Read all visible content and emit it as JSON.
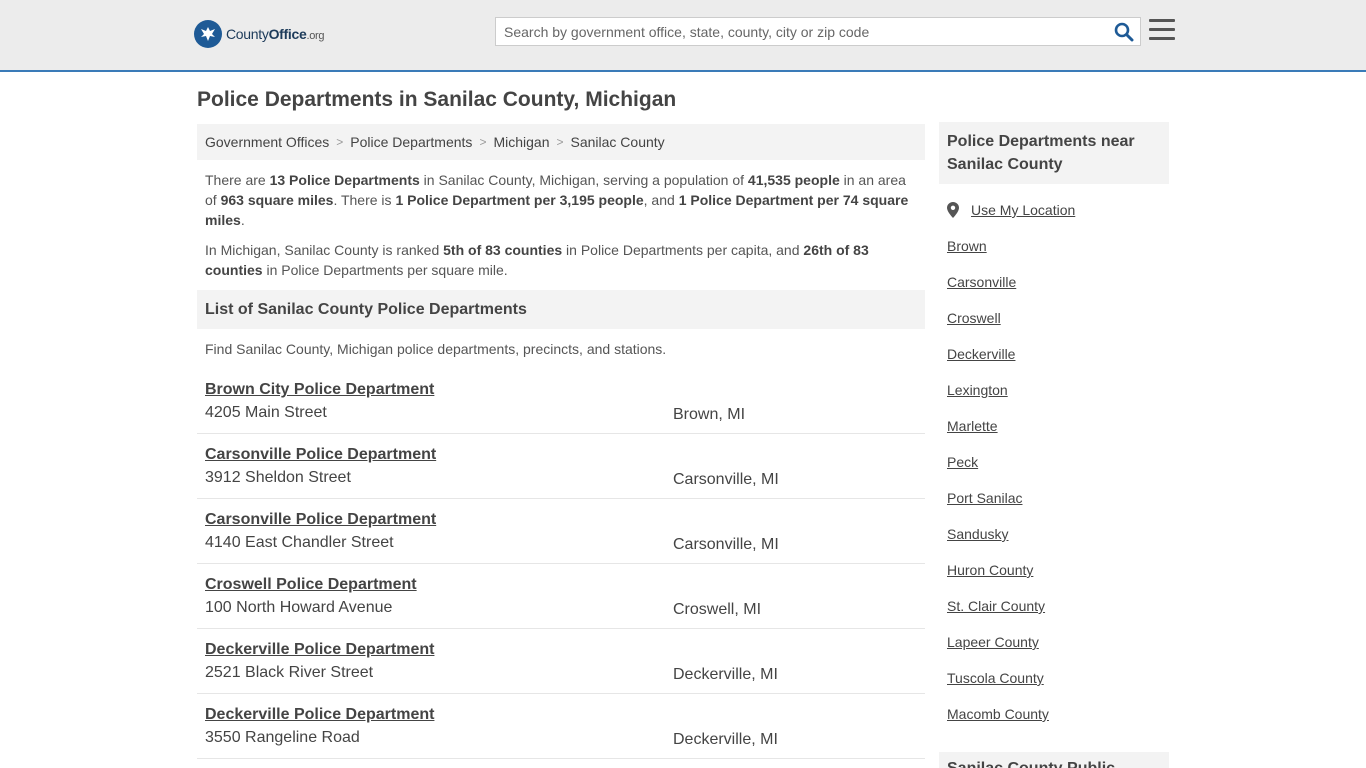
{
  "header": {
    "logo_prefix": "County",
    "logo_bold": "Office",
    "logo_tld": ".org",
    "search_placeholder": "Search by government office, state, county, city or zip code",
    "accent_color": "#3a7bb8"
  },
  "page": {
    "title": "Police Departments in Sanilac County, Michigan"
  },
  "breadcrumb": [
    "Government Offices",
    "Police Departments",
    "Michigan",
    "Sanilac County"
  ],
  "intro": {
    "p1": [
      {
        "t": "There are ",
        "b": false
      },
      {
        "t": "13 Police Departments",
        "b": true
      },
      {
        "t": " in Sanilac County, Michigan, serving a population of ",
        "b": false
      },
      {
        "t": "41,535 people",
        "b": true
      },
      {
        "t": " in an area of ",
        "b": false
      },
      {
        "t": "963 square miles",
        "b": true
      },
      {
        "t": ". There is ",
        "b": false
      },
      {
        "t": "1 Police Department per 3,195 people",
        "b": true
      },
      {
        "t": ", and ",
        "b": false
      },
      {
        "t": "1 Police Department per 74 square miles",
        "b": true
      },
      {
        "t": ".",
        "b": false
      }
    ],
    "p2": [
      {
        "t": "In Michigan, Sanilac County is ranked ",
        "b": false
      },
      {
        "t": "5th of 83 counties",
        "b": true
      },
      {
        "t": " in Police Departments per capita, and ",
        "b": false
      },
      {
        "t": "26th of 83 counties",
        "b": true
      },
      {
        "t": " in Police Departments per square mile.",
        "b": false
      }
    ]
  },
  "list": {
    "heading": "List of Sanilac County Police Departments",
    "description": "Find Sanilac County, Michigan police departments, precincts, and stations.",
    "items": [
      {
        "name": "Brown City Police Department",
        "address": "4205 Main Street",
        "city": "Brown, MI"
      },
      {
        "name": "Carsonville Police Department",
        "address": "3912 Sheldon Street",
        "city": "Carsonville, MI"
      },
      {
        "name": "Carsonville Police Department",
        "address": "4140 East Chandler Street",
        "city": "Carsonville, MI"
      },
      {
        "name": "Croswell Police Department",
        "address": "100 North Howard Avenue",
        "city": "Croswell, MI"
      },
      {
        "name": "Deckerville Police Department",
        "address": "2521 Black River Street",
        "city": "Deckerville, MI"
      },
      {
        "name": "Deckerville Police Department",
        "address": "3550 Rangeline Road",
        "city": "Deckerville, MI"
      }
    ]
  },
  "sidebar": {
    "heading": "Police Departments near Sanilac County",
    "use_location": "Use My Location",
    "links": [
      "Brown",
      "Carsonville",
      "Croswell",
      "Deckerville",
      "Lexington",
      "Marlette",
      "Peck",
      "Port Sanilac",
      "Sandusky",
      "Huron County",
      "St. Clair County",
      "Lapeer County",
      "Tuscola County",
      "Macomb County"
    ],
    "heading2": "Sanilac County Public"
  }
}
